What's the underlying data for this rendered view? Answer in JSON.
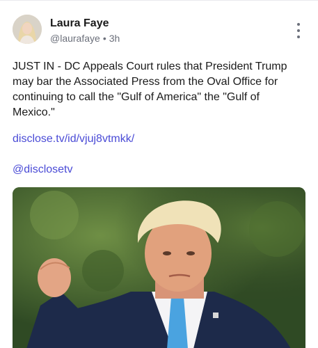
{
  "author": {
    "name": "Laura Faye",
    "handle": "@laurafaye",
    "separator": "•",
    "time": "3h"
  },
  "post": {
    "text": "JUST IN - DC Appeals Court rules that President Trump may bar the Associated Press from the Oval Office for continuing to call the \"Gulf of America\" the \"Gulf of Mexico.\"",
    "link_url": "disclose.tv/id/vjuj8vtmkk/",
    "mention": "@disclosetv"
  },
  "media": {
    "description_icon": "photo-thumbnail"
  },
  "colors": {
    "link": "#4a4bd6",
    "meta": "#6b6f7a"
  }
}
